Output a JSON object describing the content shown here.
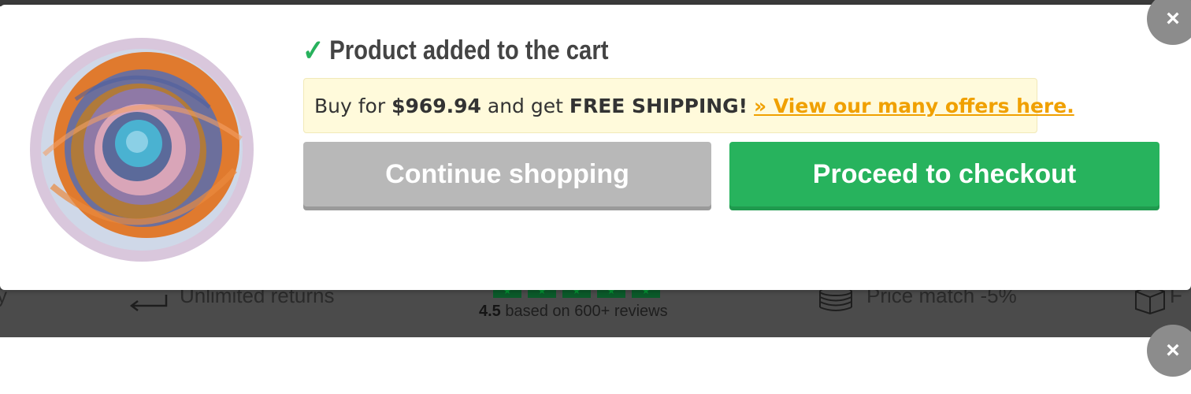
{
  "modal": {
    "title": "Product added to the cart",
    "notice": {
      "prefix": "Buy for ",
      "amount": "$969.94",
      "middle": " and get ",
      "free_shipping": "FREE SHIPPING!",
      "link": "» View our many offers here."
    },
    "continue_label": "Continue shopping",
    "checkout_label": "Proceed to checkout",
    "close_glyph": "×"
  },
  "background": {
    "left_fragment": "y",
    "unlimited_returns": "Unlimited returns",
    "rating_value": "4.5",
    "reviews_text": " based on 600+ reviews",
    "price_match": "Price match -5%",
    "right_fragment": "F"
  },
  "icons": {
    "check": "check-icon",
    "close": "close-icon",
    "return": "return-arrow-icon",
    "price": "coin-stack-icon",
    "box": "box-icon",
    "star": "star-icon"
  },
  "colors": {
    "check_green": "#27b15c",
    "checkout_green": "#27b35d",
    "continue_gray": "#b8b8b8",
    "link_orange": "#f0a000",
    "notice_bg": "#fffadb",
    "close_gray": "#8c8c8c",
    "rating_green": "#0b5a2a"
  }
}
